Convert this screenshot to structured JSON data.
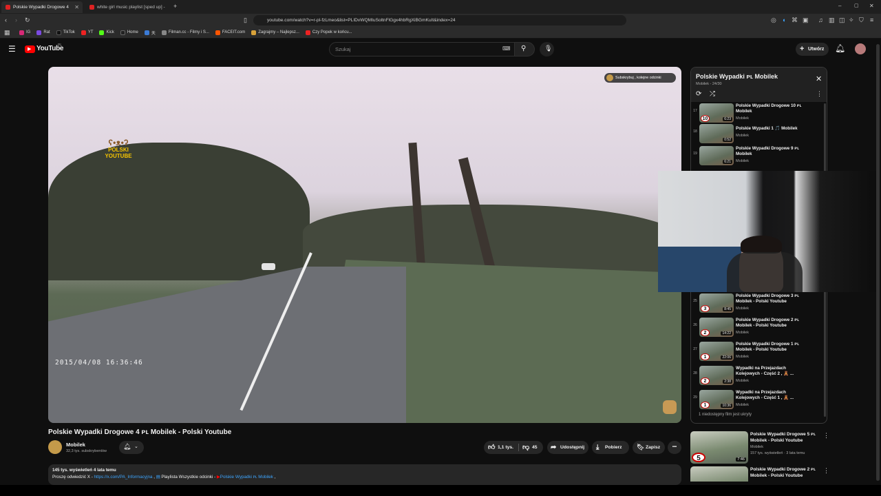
{
  "browser": {
    "tabs": [
      {
        "title": "Polskie Wypadki Drogowe 4 ",
        "active": true
      },
      {
        "title": "white girl music playlist [sped up] - ",
        "active": false
      }
    ],
    "url": "youtube.com/watch?v=r-pl-fzLmeo&list=PLIDvWQMIuSoltnFlGgx4hbRgXiBGmKuIt&index=24",
    "bookmarks": [
      "IG",
      "Rat",
      "TikTok",
      "YT",
      "Kick",
      "Home",
      "天",
      "Filman.cc - Filmy i S...",
      "FACEIT.com",
      "Zagrajmy – Najlepsz...",
      "Czy Popek w końcu..."
    ]
  },
  "youtube": {
    "logo_text": "YouTube",
    "region": "PL",
    "search_placeholder": "Szukaj",
    "create_label": "Utwórz"
  },
  "video": {
    "timestamp_overlay": "2015/04/08  16:36:46",
    "subscribe_chip": "Subskrybuj , kolejne odcinki",
    "logo_badge": "POLSKI YOUTUBE",
    "title": "Polskie Wypadki Drogowe 4 ᴘʟ Mobilek - Polski Youtube",
    "channel": "Mobilek",
    "subscribers": "32,3 tys. subskrybentów",
    "likes": "1,1 tys.",
    "dislikes": "45",
    "share_label": "Udostępnij",
    "download_label": "Pobierz",
    "save_label": "Zapisz",
    "more_label": "•••",
    "desc_meta": "145 tys. wyświetleń  4 lata temu",
    "desc_line_prefix": "Proszę odwiedzić X - ",
    "desc_link": "https://x.com/PA_Informacyjna",
    "desc_line_mid": " ,  ",
    "desc_playlist_text": " Playlista Wszystkie odcinki - ",
    "desc_playlist_link": "Polskie Wypadki ᴘʟ Mobilek",
    "desc_tail": " ,"
  },
  "playlist": {
    "title": "Polskie Wypadki ᴘʟ Mobilek",
    "subtitle": "Mobilek - 24/30",
    "items_top": [
      {
        "index": "17",
        "title": "Polskie Wypadki Drogowe 10 ᴘʟ Mobilek",
        "channel": "Mobilek",
        "duration": "6:23",
        "badge": "10"
      },
      {
        "index": "18",
        "title": "Polskie Wypadki 1 🎵 Mobilek",
        "channel": "Mobilek",
        "duration": "0:52",
        "badge": ""
      },
      {
        "index": "19",
        "title": "Polskie Wypadki Drogowe 9 ᴘʟ Mobilek",
        "channel": "Mobilek",
        "duration": "6:21",
        "badge": ""
      }
    ],
    "items_bottom": [
      {
        "index": "25",
        "title": "Polskie Wypadki Drogowe 3 ᴘʟ Mobilek - Polski Youtube",
        "channel": "Mobilek",
        "duration": "8:45",
        "badge": "3"
      },
      {
        "index": "26",
        "title": "Polskie Wypadki Drogowe 2 ᴘʟ Mobilek - Polski Youtube",
        "channel": "Mobilek",
        "duration": "14:22",
        "badge": "2"
      },
      {
        "index": "27",
        "title": "Polskie Wypadki Drogowe 1 ᴘʟ Mobilek - Polski Youtube",
        "channel": "Mobilek",
        "duration": "22:06",
        "badge": "1"
      },
      {
        "index": "28",
        "title": "Wypadki na Przejazdach Kolejowych - Część 2 , 🧸 ...",
        "channel": "Mobilek",
        "duration": "2:38",
        "badge": "2"
      },
      {
        "index": "29",
        "title": "Wypadki na Przejazdach Kolejowych - Część 1 , 🧸 ...",
        "channel": "Mobilek",
        "duration": "10:36",
        "badge": "1"
      }
    ],
    "hidden_note": "1 niedostępny film jest ukryty"
  },
  "recommended": [
    {
      "title": "Polskie Wypadki Drogowe  5  ᴘʟ Mobilek - Polski Youtube",
      "channel": "Mobilek",
      "meta": "157 tys. wyświetleń  · 3 lata temu",
      "duration": "7:46",
      "badge": "5"
    },
    {
      "title": "Polskie Wypadki Drogowe  2  ᴘʟ Mobilek - Polski Youtube",
      "channel": "",
      "meta": "",
      "duration": "",
      "badge": ""
    }
  ]
}
